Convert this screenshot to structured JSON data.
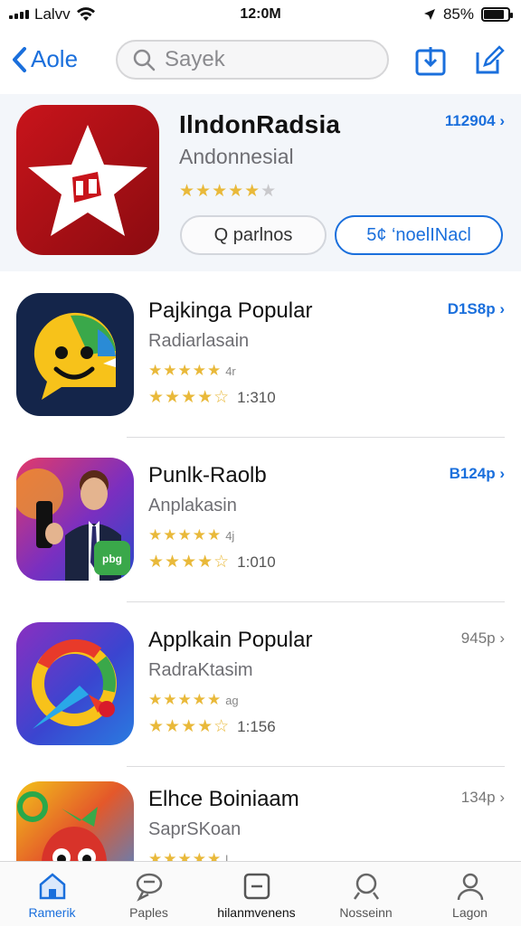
{
  "status": {
    "carrier": "Lalvv",
    "time": "12:0M",
    "battery": "85%",
    "battery_level": 0.85
  },
  "nav": {
    "back_label": "Aole",
    "search_placeholder": "Sayek"
  },
  "featured": {
    "title": "IlndonRadsia",
    "subtitle": "Andonnesial",
    "rating": 4,
    "price": "112904 ›",
    "button_left": "Q parlnos",
    "button_right": "5¢ ‘noelINacl",
    "accent": "#d0141b"
  },
  "apps": [
    {
      "title": "Pajkinga Popular",
      "subtitle": "Radiarlasain",
      "stars_top_note": "4r",
      "rating_count": "1:310",
      "price": "D1S8p ›"
    },
    {
      "title": "Punlk-Raolb",
      "subtitle": "Anplakasin",
      "stars_top_note": "4j",
      "rating_count": "1:010",
      "price": "B124p ›"
    },
    {
      "title": "Applkain Popular",
      "subtitle": "RadraKtasim",
      "stars_top_note": "ag",
      "rating_count": "1:156",
      "price": "945p ›"
    },
    {
      "title": "Elhce Boiniaam",
      "subtitle": "SaprSKoan",
      "stars_top_note": "l",
      "rating_count": "",
      "price": "134p ›"
    }
  ],
  "tabs": [
    {
      "label": "Ramerik",
      "icon": "home-icon"
    },
    {
      "label": "Paples",
      "icon": "chat-icon"
    },
    {
      "label": "hilanmvenens",
      "icon": "minus-box-icon"
    },
    {
      "label": "Nosseinn",
      "icon": "search-icon"
    },
    {
      "label": "Lagon",
      "icon": "person-icon"
    }
  ],
  "colors": {
    "accent": "#1a6fdc",
    "star": "#e9b93a"
  }
}
